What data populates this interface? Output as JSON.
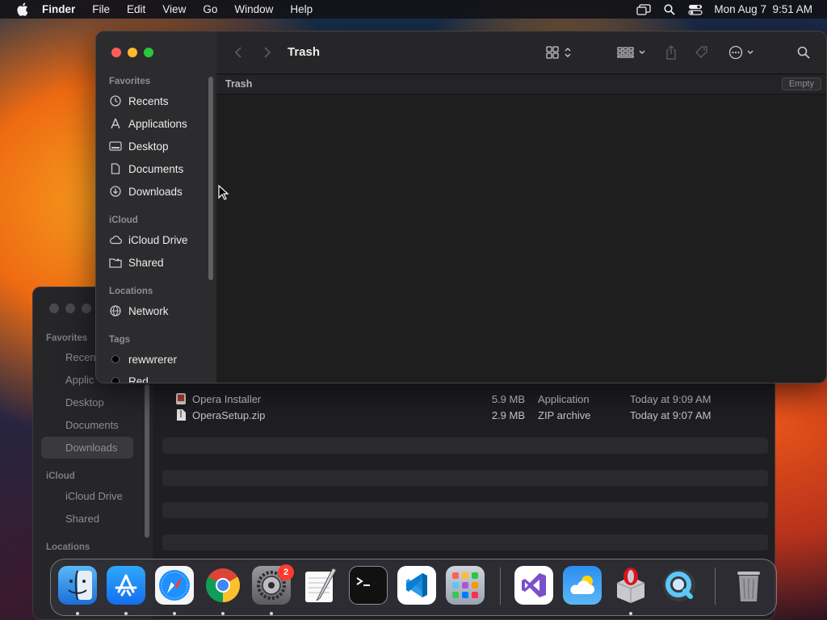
{
  "menubar": {
    "app_name": "Finder",
    "items": [
      "File",
      "Edit",
      "View",
      "Go",
      "Window",
      "Help"
    ],
    "clock": "Mon Aug 7  9:51 AM"
  },
  "finder": {
    "title": "Trash",
    "path_label": "Trash",
    "empty_button": "Empty",
    "sidebar": {
      "favorites_header": "Favorites",
      "favorites": [
        "Recents",
        "Applications",
        "Desktop",
        "Documents",
        "Downloads"
      ],
      "icloud_header": "iCloud",
      "icloud": [
        "iCloud Drive",
        "Shared"
      ],
      "locations_header": "Locations",
      "locations": [
        "Network"
      ],
      "tags_header": "Tags",
      "tags": [
        "rewwrerer",
        "Red"
      ]
    }
  },
  "background_window": {
    "sidebar": {
      "favorites_header": "Favorites",
      "favorites": [
        "Recen",
        "Applic",
        "Desktop",
        "Documents",
        "Downloads"
      ],
      "icloud_header": "iCloud",
      "icloud": [
        "iCloud Drive",
        "Shared"
      ],
      "locations_header": "Locations"
    },
    "files": [
      {
        "name": "Opera Installer",
        "size": "5.9 MB",
        "kind": "Application",
        "date": "Today at 9:09 AM"
      },
      {
        "name": "OperaSetup.zip",
        "size": "2.9 MB",
        "kind": "ZIP archive",
        "date": "Today at 9:07 AM"
      }
    ]
  },
  "dock": {
    "apps": [
      "Finder",
      "App Store",
      "Safari",
      "Chrome",
      "System Settings",
      "TextEdit",
      "Terminal",
      "VS Code",
      "Launchpad",
      "Visual Studio",
      "Weather",
      "Opera Installer",
      "QuickTime Player",
      "Trash"
    ],
    "settings_badge": "2"
  },
  "colors": {
    "close": "#ff5f57",
    "minimize": "#febc2e",
    "zoom": "#28c840"
  }
}
